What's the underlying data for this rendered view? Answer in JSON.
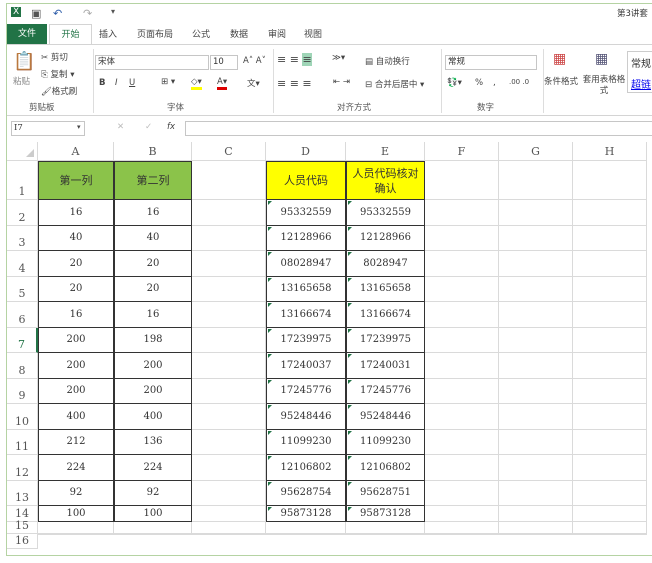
{
  "title": "第3讲套",
  "tabs": [
    "文件",
    "开始",
    "插入",
    "页面布局",
    "公式",
    "数据",
    "审阅",
    "视图"
  ],
  "ribbon": {
    "clipboard": {
      "paste": "粘贴",
      "cut": "剪切",
      "copy": "复制",
      "format_painter": "格式刷",
      "group": "剪贴板"
    },
    "font": {
      "name": "宋体",
      "size": "10",
      "bold": "B",
      "italic": "I",
      "underline": "U",
      "group": "字体"
    },
    "alignment": {
      "wrap": "自动换行",
      "merge": "合并后居中",
      "group": "对齐方式"
    },
    "number": {
      "format": "常规",
      "percent": "%",
      "comma": ",",
      "group": "数字"
    },
    "styles": {
      "conditional": "条件格式",
      "table": "套用表格格式",
      "cell_style": "常规",
      "hyperlink": "超链"
    }
  },
  "formula_bar": {
    "name_box": "I7",
    "fx": "fx",
    "value": ""
  },
  "columns": [
    "A",
    "B",
    "C",
    "D",
    "E",
    "F",
    "G",
    "H"
  ],
  "rows": [
    "1",
    "2",
    "3",
    "4",
    "5",
    "6",
    "7",
    "8",
    "9",
    "10",
    "11",
    "12",
    "13",
    "14",
    "15",
    "16"
  ],
  "active_row": "7",
  "colors": {
    "green_header": "#8bc34a",
    "yellow_header": "#ffff00",
    "accent": "#217346"
  },
  "table1": {
    "headers": [
      "第一列",
      "第二列"
    ],
    "data": [
      [
        "16",
        "16"
      ],
      [
        "40",
        "40"
      ],
      [
        "20",
        "20"
      ],
      [
        "20",
        "20"
      ],
      [
        "16",
        "16"
      ],
      [
        "200",
        "198"
      ],
      [
        "200",
        "200"
      ],
      [
        "200",
        "200"
      ],
      [
        "400",
        "400"
      ],
      [
        "212",
        "136"
      ],
      [
        "224",
        "224"
      ],
      [
        "92",
        "92"
      ],
      [
        "100",
        "100"
      ]
    ]
  },
  "table2": {
    "headers": [
      "人员代码",
      "人员代码核对确认"
    ],
    "data": [
      [
        "95332559",
        "95332559"
      ],
      [
        "12128966",
        "12128966"
      ],
      [
        "08028947",
        "8028947"
      ],
      [
        "13165658",
        "13165658"
      ],
      [
        "13166674",
        "13166674"
      ],
      [
        "17239975",
        "17239975"
      ],
      [
        "17240037",
        "17240031"
      ],
      [
        "17245776",
        "17245776"
      ],
      [
        "95248446",
        "95248446"
      ],
      [
        "11099230",
        "11099230"
      ],
      [
        "12106802",
        "12106802"
      ],
      [
        "95628754",
        "95628751"
      ],
      [
        "95873128",
        "95873128"
      ]
    ]
  }
}
